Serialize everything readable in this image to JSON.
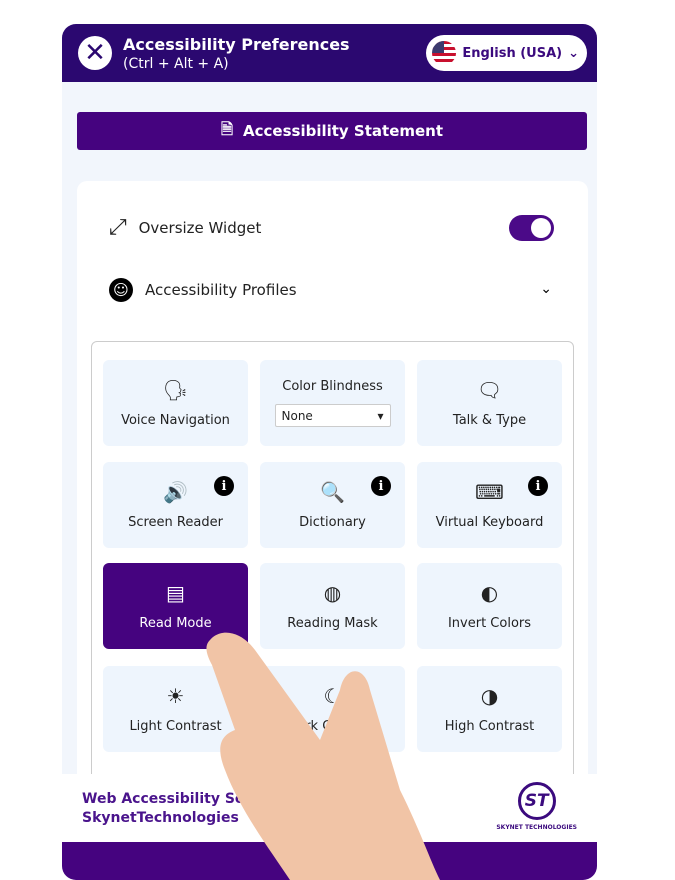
{
  "header": {
    "title": "Accessibility Preferences",
    "shortcut": "(Ctrl + Alt + A)",
    "close_icon": "close-icon",
    "language": "English (USA)"
  },
  "statement_button": "Accessibility Statement",
  "settings": {
    "oversize_widget": "Oversize Widget",
    "oversize_enabled": true,
    "profiles": "Accessibility Profiles"
  },
  "tiles": [
    {
      "label": "Voice Navigation",
      "icon": "🗣"
    },
    {
      "label": "Color Blindness",
      "select_value": "None"
    },
    {
      "label": "Talk & Type",
      "icon": "🗨"
    },
    {
      "label": "Screen Reader",
      "icon": "🔊",
      "info": "i"
    },
    {
      "label": "Dictionary",
      "icon": "🔍",
      "info": "i"
    },
    {
      "label": "Virtual Keyboard",
      "icon": "⌨",
      "info": "i"
    },
    {
      "label": "Read Mode",
      "icon": "▤",
      "active": true
    },
    {
      "label": "Reading Mask",
      "icon": "◍"
    },
    {
      "label": "Invert Colors",
      "icon": "◐"
    },
    {
      "label": "Light Contrast",
      "icon": "☀"
    },
    {
      "label": "Dark Contrast",
      "icon": "☾"
    },
    {
      "label": "High Contrast",
      "icon": "◑"
    }
  ],
  "footer": {
    "line1": "Web Accessibility Sol",
    "line2": "SkynetTechnologies",
    "logo_text": "ST",
    "logo_name": "SKYNET TECHNOLOGIES"
  },
  "colors": {
    "primary": "#45037f",
    "header": "#2b0870"
  }
}
